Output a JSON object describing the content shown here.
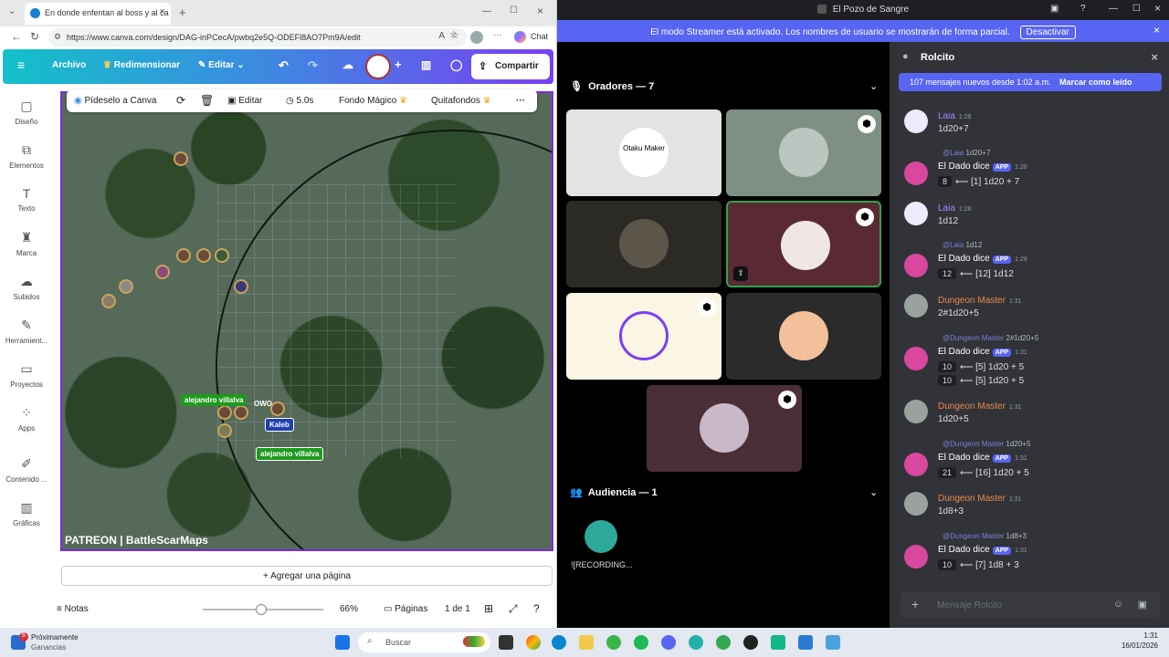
{
  "browser": {
    "tab_title": "En donde enfentan al boss y al ca",
    "url": "https://www.canva.com/design/DAG-inPCecA/pwbq2e5Q-ODEFl8AO7Pm9A/edit",
    "chat_label": "Chat"
  },
  "canva": {
    "menu": [
      "Archivo",
      "Redimensionar",
      "Editar"
    ],
    "share": "Compartir",
    "float_toolbar": {
      "ask": "Pídeselo a Canva",
      "edit": "Editar",
      "duration": "5.0s",
      "magic": "Fondo Mágico",
      "remove_bg": "Quitafondos"
    },
    "rail": [
      "Diseño",
      "Elementos",
      "Texto",
      "Marca",
      "Subidos",
      "Herramient...",
      "Proyectos",
      "Apps",
      "Contenido ...",
      "Gráficas"
    ],
    "map_tags": [
      "alejandro villalva",
      "OWO",
      "Kaleb",
      "alejandro villalva"
    ],
    "watermark": "PATREON | BattleScarMaps",
    "add_page": "+ Agregar una página",
    "bottom": {
      "notes": "Notas",
      "zoom": "66%",
      "pages": "Páginas",
      "page_count": "1 de 1"
    }
  },
  "discord": {
    "window_title": "El Pozo de Sangre",
    "streamer_banner": "El modo Streamer está activado. Los nombres de usuario se mostrarán de forma parcial.",
    "deactivate": "Desactivar",
    "speakers_header": "Oradores — 7",
    "audience_header": "Audiencia — 1",
    "audience_member": "![RECORDING...",
    "tile1_text": "Otaku Maker",
    "chat": {
      "channel": "Rolcito",
      "new_messages": "107 mensajes nuevos desde 1:02 a.m.",
      "mark_read": "Marcar como leído",
      "input_placeholder": "Mensaje Rolcito",
      "messages": [
        {
          "author": "Laia",
          "time": "1:28",
          "text": "1d20+7"
        },
        {
          "reply_to": "@Laia",
          "reply_text": "1d20+7",
          "author": "El Dado dice",
          "badge": "APP",
          "time": "1:28",
          "dice": [
            "8",
            "⟵ [1] 1d20 + 7"
          ]
        },
        {
          "author": "Laia",
          "time": "1:28",
          "text": "1d12"
        },
        {
          "reply_to": "@Laia",
          "reply_text": "1d12",
          "author": "El Dado dice",
          "badge": "APP",
          "time": "1:28",
          "dice": [
            "12",
            "⟵ [12] 1d12"
          ]
        },
        {
          "author": "Dungeon Master",
          "time": "1:31",
          "text": "2#1d20+5"
        },
        {
          "reply_to": "@Dungeon Master",
          "reply_text": "2#1d20+5",
          "author": "El Dado dice",
          "badge": "APP",
          "time": "1:31",
          "dice": [
            "10",
            "⟵ [5] 1d20 + 5"
          ],
          "dice2": [
            "10",
            "⟵ [5] 1d20 + 5"
          ]
        },
        {
          "author": "Dungeon Master",
          "time": "1:31",
          "text": "1d20+5"
        },
        {
          "reply_to": "@Dungeon Master",
          "reply_text": "1d20+5",
          "author": "El Dado dice",
          "badge": "APP",
          "time": "1:31",
          "dice": [
            "21",
            "⟵ [16] 1d20 + 5"
          ]
        },
        {
          "author": "Dungeon Master",
          "time": "1:31",
          "text": "1d8+3"
        },
        {
          "reply_to": "@Dungeon Master",
          "reply_text": "1d8+3",
          "author": "El Dado dice",
          "badge": "APP",
          "time": "1:31",
          "dice": [
            "10",
            "⟵ [7] 1d8 + 3"
          ]
        }
      ]
    }
  },
  "taskbar": {
    "weather_title": "Próximamente",
    "weather_sub": "Ganancias",
    "weather_badge": "6",
    "search": "Buscar",
    "time": "1:31",
    "date": "16/01/2026"
  },
  "colors": {
    "discord_blurple": "#5865f2",
    "dm_orange": "#e9894b",
    "laia_purple": "#a78bfa",
    "canva_purple": "#7d2ae8"
  }
}
